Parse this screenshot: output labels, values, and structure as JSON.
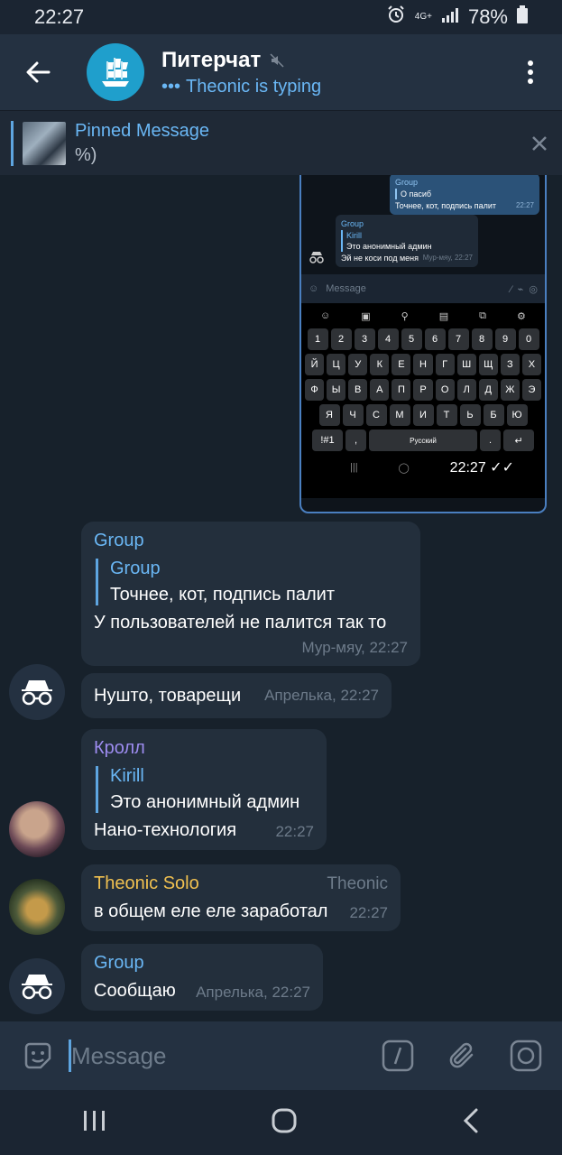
{
  "status": {
    "time": "22:27",
    "network": "4G+",
    "battery": "78%"
  },
  "header": {
    "title": "Питерчат",
    "typing": "Theonic is typing"
  },
  "pinned": {
    "title": "Pinned Message",
    "body": "%)"
  },
  "screenshot": {
    "msg1_sender": "Group",
    "msg1_quote": "О пасиб",
    "msg1_text": "Точнее, кот, подпись палит",
    "msg1_time": "22:27",
    "msg2_sender": "Group",
    "msg2_quote_name": "Kirill",
    "msg2_quote": "Это анонимный админ",
    "msg2_text": "Эй не коси под меня",
    "msg2_time": "Мур-мяу, 22:27",
    "input_placeholder": "Message",
    "keys_row1": [
      "1",
      "2",
      "3",
      "4",
      "5",
      "6",
      "7",
      "8",
      "9",
      "0"
    ],
    "keys_row2": [
      "Й",
      "Ц",
      "У",
      "К",
      "Е",
      "Н",
      "Г",
      "Ш",
      "Щ",
      "З",
      "Х"
    ],
    "keys_row3": [
      "Ф",
      "Ы",
      "В",
      "А",
      "П",
      "Р",
      "О",
      "Л",
      "Д",
      "Ж",
      "Э"
    ],
    "keys_row4": [
      "Я",
      "Ч",
      "С",
      "М",
      "И",
      "Т",
      "Ь",
      "Б",
      "Ю"
    ],
    "key_symbols": "!#1",
    "key_comma": ",",
    "key_space": "Русский",
    "key_dot": ".",
    "time": "22:27"
  },
  "messages": {
    "m1": {
      "sender": "Group",
      "quote_name": "Group",
      "quote_text": "Точнее, кот, подпись палит",
      "text": "У пользователей не палится так то",
      "meta": "Мур-мяу, 22:27"
    },
    "m2": {
      "text": "Нушто, товарещи",
      "meta": "Апрелька, 22:27"
    },
    "m3": {
      "sender": "Кролл",
      "quote_name": "Kirill",
      "quote_text": "Это анонимный админ",
      "text": "Нано-технология",
      "meta": "22:27"
    },
    "m4": {
      "sender": "Theonic Solo",
      "role": "Theonic",
      "text": "в общем еле еле заработал",
      "meta": "22:27"
    },
    "m5": {
      "sender": "Group",
      "text": "Сообщаю",
      "meta": "Апрелька, 22:27"
    }
  },
  "compose": {
    "placeholder": "Message"
  },
  "colors": {
    "accent": "#6ab7f5",
    "kroll": "#9d8cf0",
    "theonic": "#f0c050",
    "bubble": "#232f3c",
    "background": "#17212b"
  }
}
